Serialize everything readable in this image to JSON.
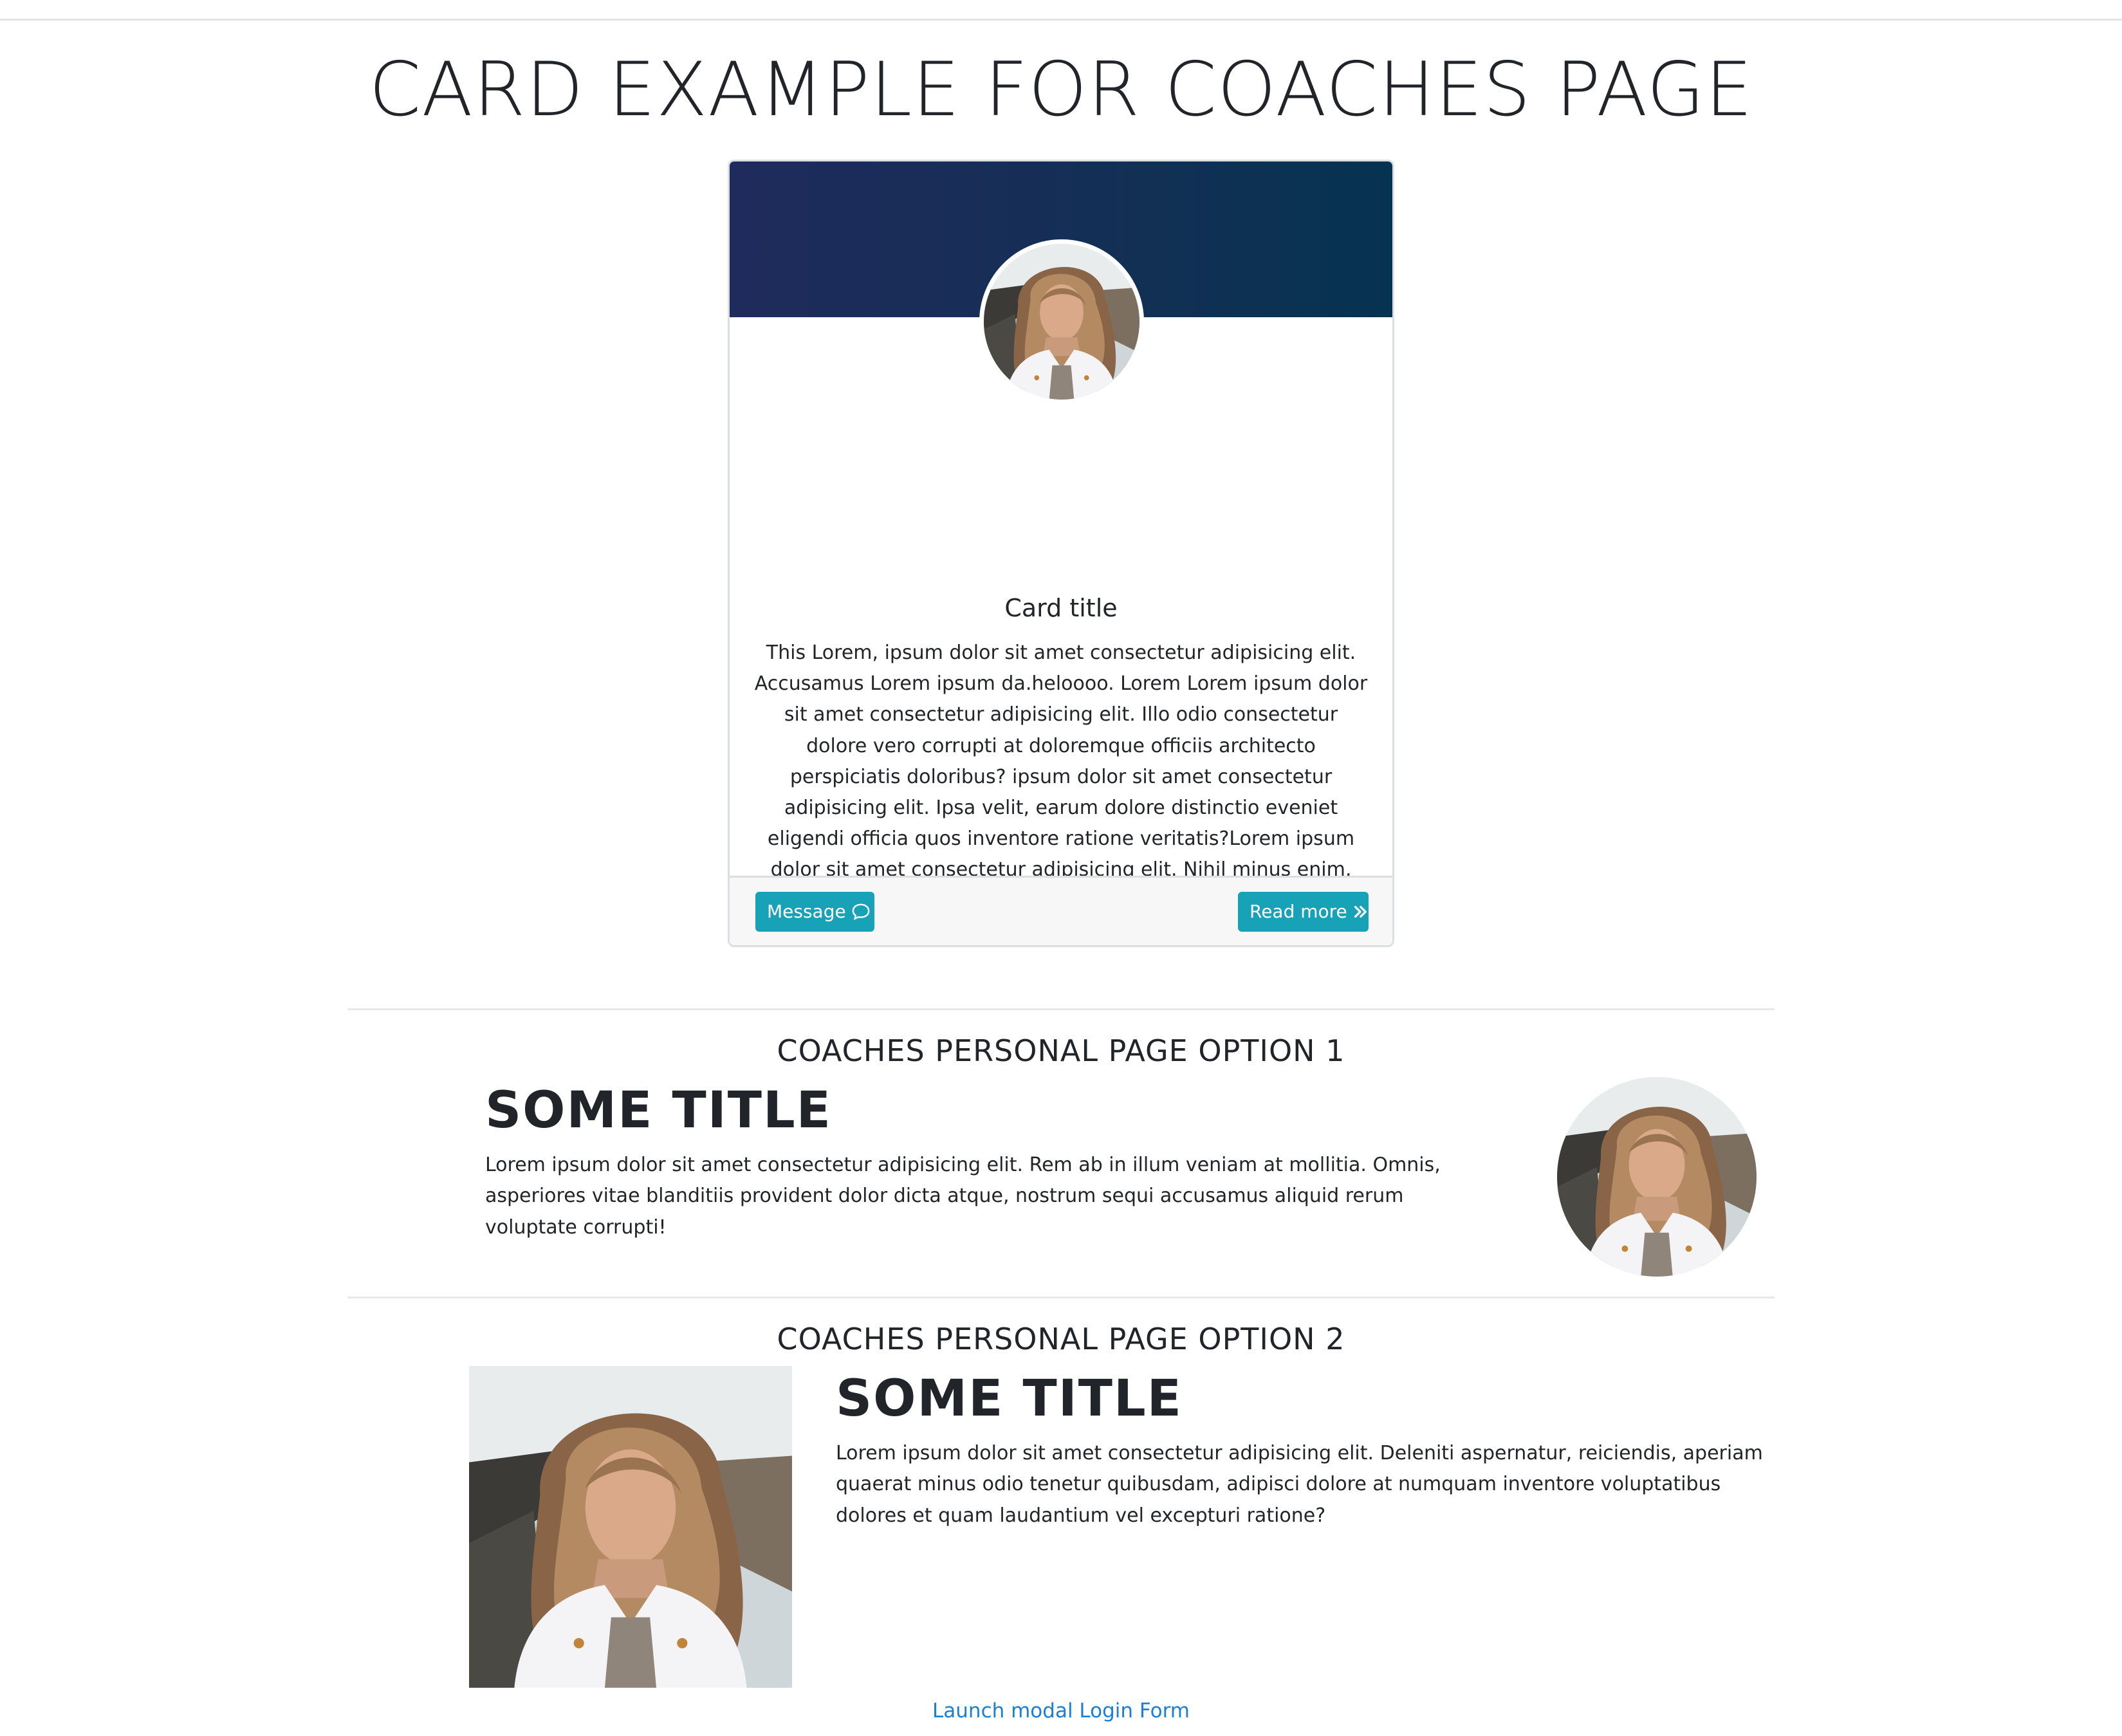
{
  "page": {
    "title": "CARD EXAMPLE FOR COACHES PAGE"
  },
  "card": {
    "title": "Card title",
    "text": "This Lorem, ipsum dolor sit amet consectetur adipisicing elit. Accusamus Lorem ipsum da.heloooo. Lorem Lorem ipsum dolor sit amet consectetur adipisicing elit. Illo odio consectetur dolore vero corrupti at doloremque officiis architecto perspiciatis doloribus? ipsum dolor sit amet consectetur adipisicing elit. Ipsa velit, earum dolore distinctio eveniet eligendi officia quos inventore ratione veritatis?Lorem ipsum dolor sit amet consectetur adipisicing elit. Nihil minus enim, laudantium quisquam iure rerum voluptates? Temporibus facilis quidem sequi atque at odit non totam placeat rerum perspiciatis? Omnis voluptates deleniti blanditiis iste maxime. Quas quidem quaerat illo ipsam vel sunt, excepturi accusantium corrupti debitis reiciendis doloremque maiores laborum modi.",
    "message_label": "Message",
    "message_icon": "chat-bubble-icon",
    "read_more_label": "Read more",
    "read_more_icon": "double-chevron-right-icon",
    "header_color_start": "#1f2b5c",
    "header_color_end": "#063351",
    "button_color": "#17a2b8"
  },
  "option1": {
    "heading": "COACHES PERSONAL PAGE OPTION 1",
    "title": "SOME TITLE",
    "text": "Lorem ipsum dolor sit amet consectetur adipisicing elit. Rem ab in illum veniam at mollitia. Omnis, asperiores vitae blanditiis provident dolor dicta atque, nostrum sequi accusamus aliquid rerum voluptate corrupti!"
  },
  "option2": {
    "heading": "COACHES PERSONAL PAGE OPTION 2",
    "title": "SOME TITLE",
    "text": "Lorem ipsum dolor sit amet consectetur adipisicing elit. Deleniti aspernatur, reiciendis, aperiam quaerat minus odio tenetur quibusdam, adipisci dolore at numquam inventore voluptatibus dolores et quam laudantium vel excepturi ratione?"
  },
  "footer": {
    "modal_link": "Launch modal Login Form",
    "link_color": "#1a7fd6"
  }
}
